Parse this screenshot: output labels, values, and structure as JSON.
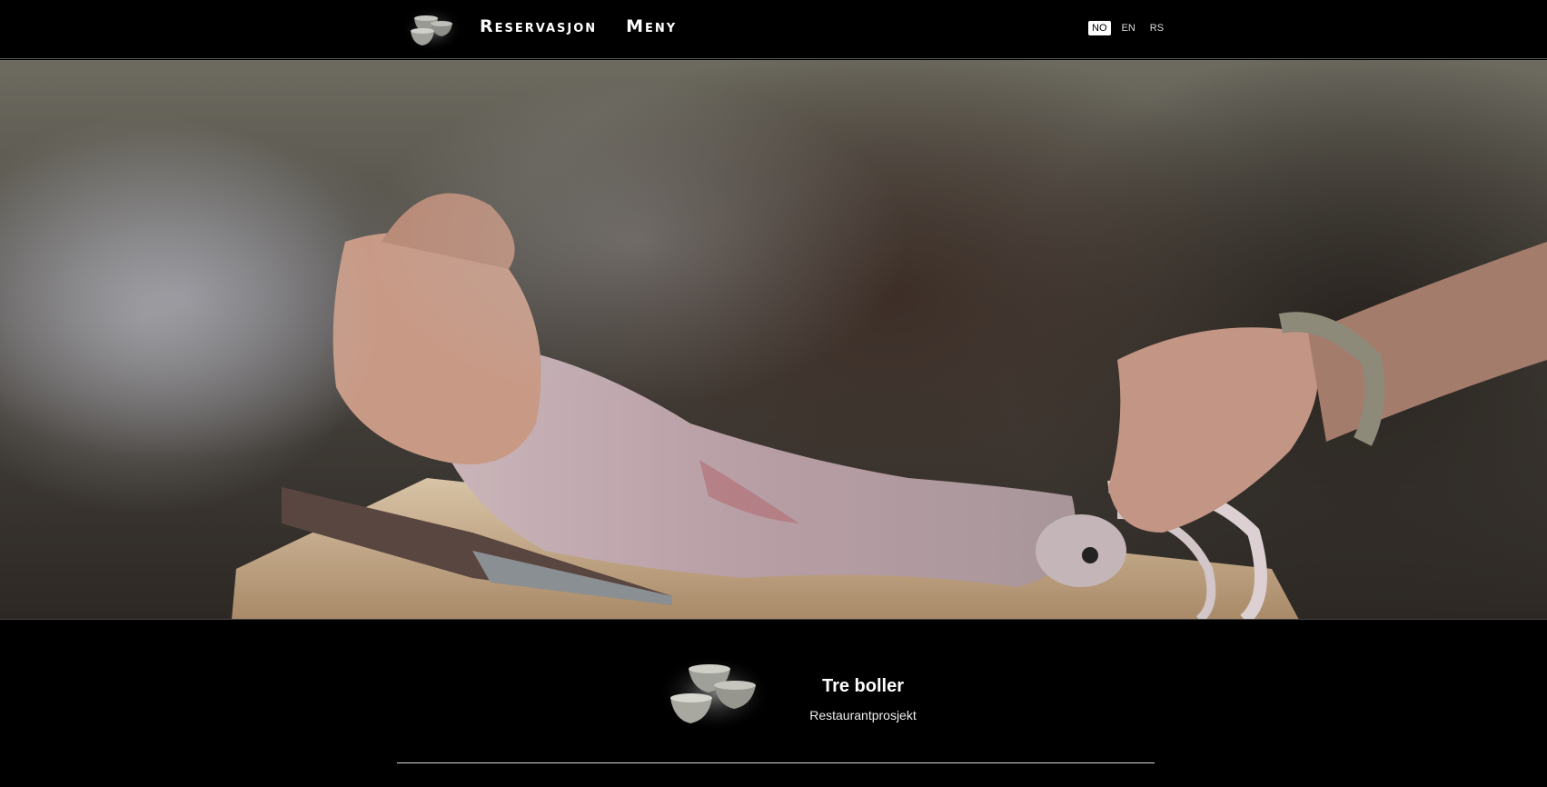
{
  "header": {
    "logo_icon": "three-bowls-logo",
    "nav": [
      {
        "label": "Reservasjon"
      },
      {
        "label": "Meny"
      }
    ],
    "languages": [
      {
        "code": "NO",
        "active": true
      },
      {
        "code": "EN",
        "active": false
      },
      {
        "code": "RS",
        "active": false
      }
    ]
  },
  "hero": {
    "image_subject": "squid-preparation-video"
  },
  "footer": {
    "logo_icon": "three-bowls-logo",
    "title": "Tre boller",
    "subtitle": "Restaurantprosjekt"
  },
  "colors": {
    "background": "#000000",
    "text": "#ffffff",
    "active_lang_bg": "#ffffff"
  }
}
